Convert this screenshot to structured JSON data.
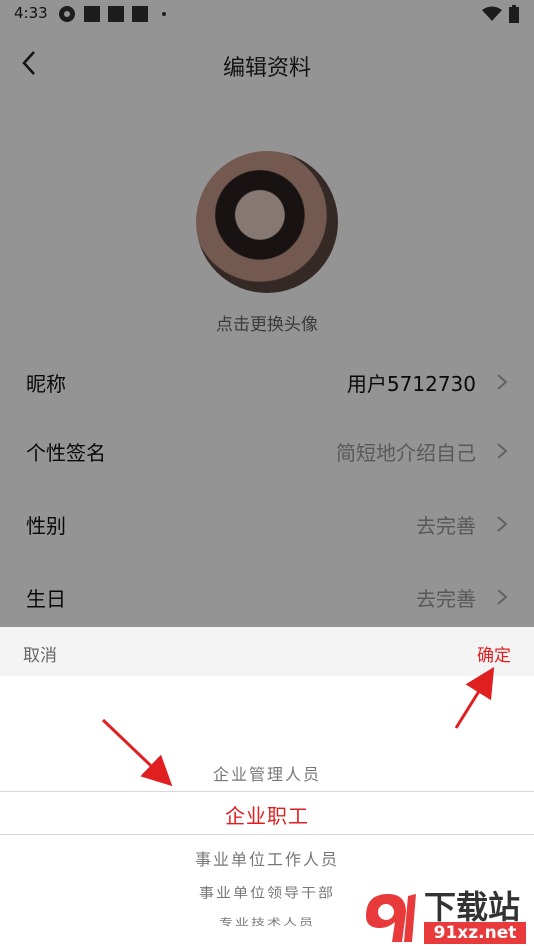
{
  "status_bar": {
    "time": "4:33"
  },
  "header": {
    "title": "编辑资料"
  },
  "avatar": {
    "hint": "点击更换头像"
  },
  "rows": [
    {
      "label": "昵称",
      "value": "用户5712730"
    },
    {
      "label": "个性签名",
      "value": "简短地介绍自己"
    },
    {
      "label": "性别",
      "value": "去完善"
    },
    {
      "label": "生日",
      "value": "去完善"
    }
  ],
  "picker": {
    "cancel_label": "取消",
    "confirm_label": "确定",
    "options": [
      "企业管理人员",
      "企业职工",
      "事业单位工作人员",
      "事业单位领导干部",
      "专业技术人员"
    ],
    "selected": "企业职工"
  },
  "watermark": {
    "brand": "下载站",
    "domain": "91xz.net"
  },
  "colors": {
    "accent": "#e02020",
    "arrow": "#e02020"
  }
}
